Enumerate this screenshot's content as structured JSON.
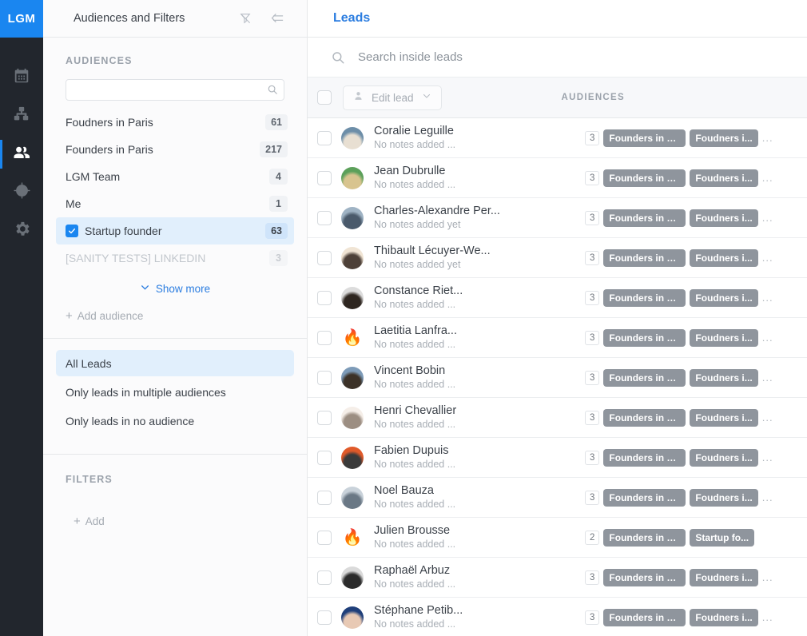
{
  "brand": {
    "logo": "LGM",
    "logo_bg": "#1a86f0"
  },
  "rail": {
    "items": [
      {
        "name": "calendar-icon",
        "label": "Calendar"
      },
      {
        "name": "sitemap-icon",
        "label": "Campaigns"
      },
      {
        "name": "people-icon",
        "label": "Leads",
        "active": true
      },
      {
        "name": "target-person-icon",
        "label": "Prospecting"
      },
      {
        "name": "gear-icon",
        "label": "Settings"
      }
    ]
  },
  "topbar": {
    "title": "Leads"
  },
  "panel": {
    "header_title": "Audiences and Filters",
    "filter_off_icon": "filter-off-icon",
    "collapse_icon": "collapse-panel-icon",
    "audiences_title": "AUDIENCES",
    "audience_search_placeholder": "",
    "audience_search_value": "",
    "audiences": [
      {
        "label": "Foudners in Paris",
        "count": "61",
        "selected": false,
        "muted": false
      },
      {
        "label": "Founders in Paris",
        "count": "217",
        "selected": false,
        "muted": false
      },
      {
        "label": "LGM Team",
        "count": "4",
        "selected": false,
        "muted": false
      },
      {
        "label": "Me",
        "count": "1",
        "selected": false,
        "muted": false
      },
      {
        "label": "Startup founder",
        "count": "63",
        "selected": true,
        "muted": false
      },
      {
        "label": "[SANITY TESTS] LINKEDIN",
        "count": "3",
        "selected": false,
        "muted": true
      }
    ],
    "show_more_label": "Show more",
    "add_audience_label": "Add audience",
    "scopes": [
      {
        "label": "All Leads",
        "selected": true
      },
      {
        "label": "Only leads in multiple audiences",
        "selected": false
      },
      {
        "label": "Only leads in no audience",
        "selected": false
      }
    ],
    "filters_title": "FILTERS",
    "add_filter_label": "Add"
  },
  "search": {
    "placeholder": "Search inside leads",
    "value": ""
  },
  "table": {
    "edit_lead_label": "Edit lead",
    "audiences_column": "AUDIENCES",
    "rows": [
      {
        "name": "Coralie Leguille",
        "note": "No notes added ...",
        "count": "3",
        "chips": [
          "Founders in Paris",
          "Foudners i..."
        ],
        "more": "...",
        "avatar": {
          "type": "photo",
          "c1": "#6d8ea8",
          "c2": "#e8dfd2"
        }
      },
      {
        "name": "Jean Dubrulle",
        "note": "No notes added ...",
        "count": "3",
        "chips": [
          "Founders in Paris",
          "Foudners i..."
        ],
        "more": "...",
        "avatar": {
          "type": "photo",
          "c1": "#5ca05a",
          "c2": "#d8c48f"
        }
      },
      {
        "name": "Charles-Alexandre Per...",
        "note": "No notes added yet",
        "count": "3",
        "chips": [
          "Founders in Paris",
          "Foudners i..."
        ],
        "more": "...",
        "avatar": {
          "type": "photo",
          "c1": "#9fb3c4",
          "c2": "#4a5a6b"
        }
      },
      {
        "name": "Thibault Lécuyer-We...",
        "note": "No notes added yet",
        "count": "3",
        "chips": [
          "Founders in Paris",
          "Foudners i..."
        ],
        "more": "...",
        "avatar": {
          "type": "photo",
          "c1": "#f0e4d4",
          "c2": "#4d4038"
        }
      },
      {
        "name": "Constance Riet...",
        "note": "No notes added ...",
        "count": "3",
        "chips": [
          "Founders in Paris",
          "Foudners i..."
        ],
        "more": "...",
        "avatar": {
          "type": "photo",
          "c1": "#dcdcdc",
          "c2": "#2e2620"
        }
      },
      {
        "name": "Laetitia Lanfra...",
        "note": "No notes added ...",
        "count": "3",
        "chips": [
          "Founders in Paris",
          "Foudners i..."
        ],
        "more": "...",
        "avatar": {
          "type": "emoji",
          "glyph": "🔥"
        }
      },
      {
        "name": "Vincent Bobin",
        "note": "No notes added ...",
        "count": "3",
        "chips": [
          "Founders in Paris",
          "Foudners i..."
        ],
        "more": "...",
        "avatar": {
          "type": "photo",
          "c1": "#7d9bb8",
          "c2": "#3c3228"
        }
      },
      {
        "name": "Henri Chevallier",
        "note": "No notes added ...",
        "count": "3",
        "chips": [
          "Founders in Paris",
          "Foudners i..."
        ],
        "more": "...",
        "avatar": {
          "type": "photo",
          "c1": "#f5eee8",
          "c2": "#9c8e82"
        }
      },
      {
        "name": "Fabien Dupuis",
        "note": "No notes added ...",
        "count": "3",
        "chips": [
          "Founders in Paris",
          "Foudners i..."
        ],
        "more": "...",
        "avatar": {
          "type": "photo",
          "c1": "#e05a2a",
          "c2": "#3a3a3a"
        }
      },
      {
        "name": "Noel Bauza",
        "note": "No notes added ...",
        "count": "3",
        "chips": [
          "Founders in Paris",
          "Foudners i..."
        ],
        "more": "...",
        "avatar": {
          "type": "photo",
          "c1": "#c9d2da",
          "c2": "#6a7885"
        }
      },
      {
        "name": "Julien Brousse",
        "note": "No notes added ...",
        "count": "2",
        "chips": [
          "Founders in Paris",
          "Startup fo..."
        ],
        "more": "",
        "avatar": {
          "type": "emoji",
          "glyph": "🔥"
        }
      },
      {
        "name": "Raphaël Arbuz",
        "note": "No notes added ...",
        "count": "3",
        "chips": [
          "Founders in Paris",
          "Foudners i..."
        ],
        "more": "...",
        "avatar": {
          "type": "photo",
          "c1": "#dadada",
          "c2": "#2b2b2b"
        }
      },
      {
        "name": "Stéphane Petib...",
        "note": "No notes added ...",
        "count": "3",
        "chips": [
          "Founders in Paris",
          "Foudners i..."
        ],
        "more": "...",
        "avatar": {
          "type": "photo",
          "c1": "#1f3f7a",
          "c2": "#e8c9b4"
        }
      }
    ]
  }
}
